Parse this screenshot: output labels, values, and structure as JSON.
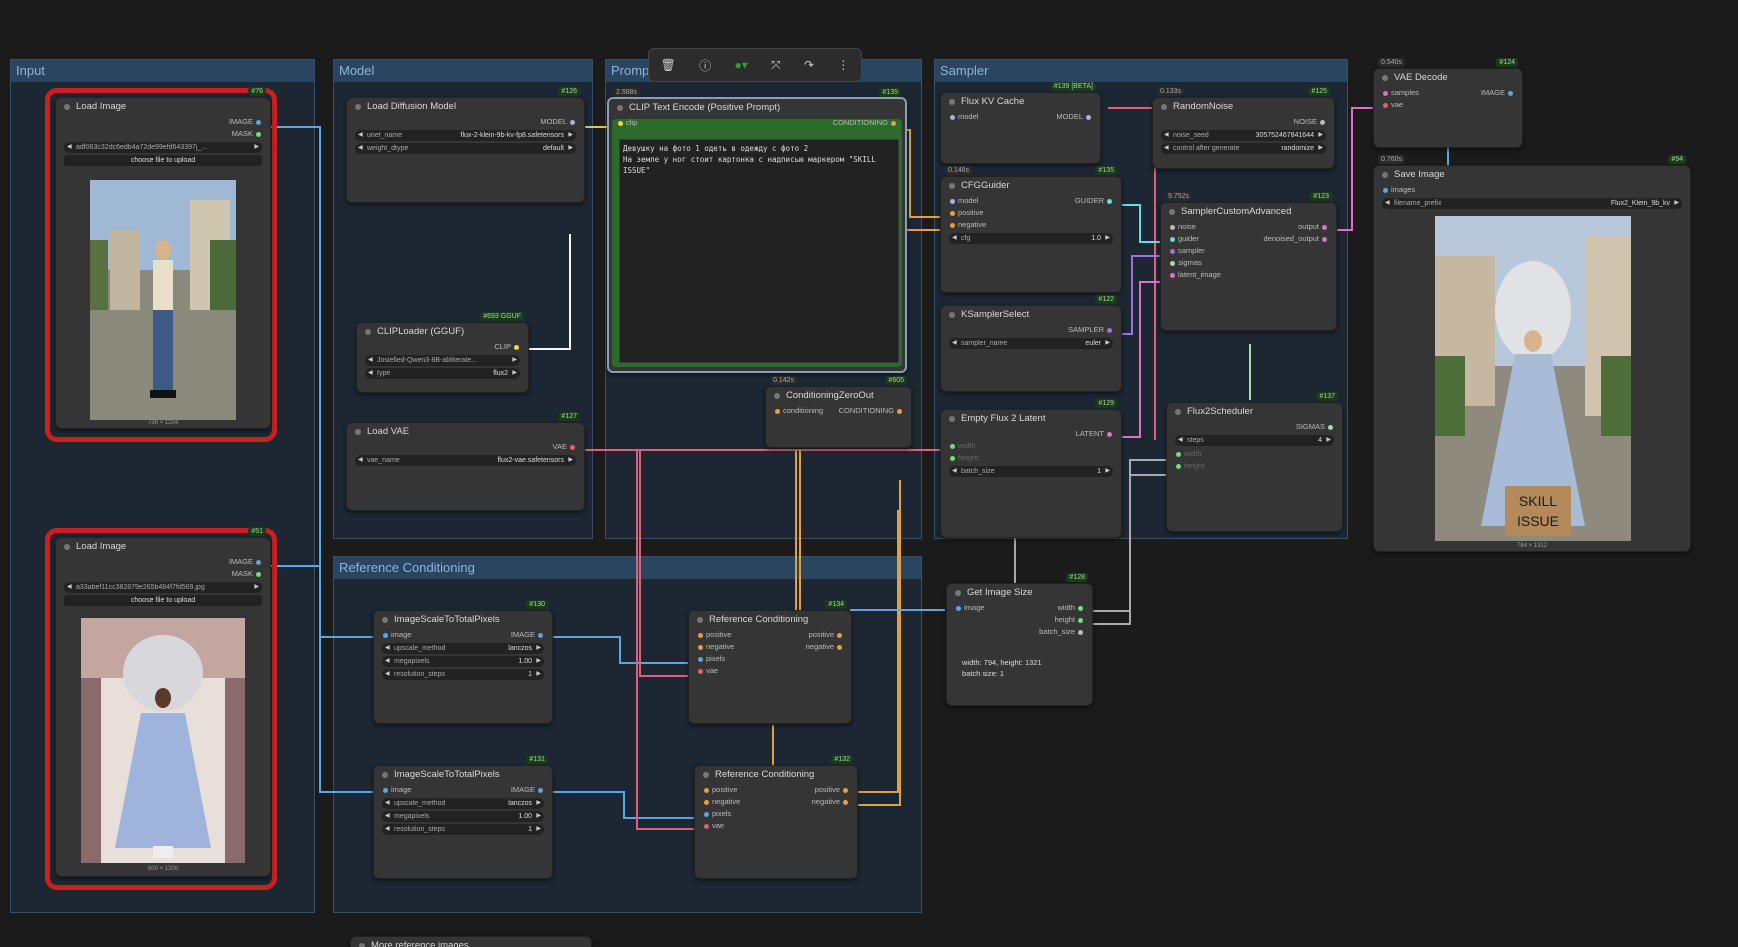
{
  "groups": {
    "input": "Input",
    "model": "Model",
    "prompt": "Promp",
    "sampler": "Sampler",
    "refcond": "Reference Conditioning"
  },
  "load1": {
    "title": "Load Image",
    "id": "#76",
    "out1": "IMAGE",
    "out2": "MASK",
    "file": "adf063c32dc6edb4a72de99efd643397j_...",
    "upload": "choose file to upload",
    "size": "736 × 1224"
  },
  "load2": {
    "title": "Load Image",
    "id": "#51",
    "out1": "IMAGE",
    "out2": "MASK",
    "file": "a33abef11cc382879e265b484f7fd569.jpg",
    "upload": "choose file to upload",
    "size": "500 × 1200"
  },
  "diff": {
    "title": "Load Diffusion Model",
    "id": "#126",
    "out": "MODEL",
    "w1l": "unet_name",
    "w1v": "flux-2-klein-9b-kv-fp8.safetensors",
    "w2l": "weight_dtype",
    "w2v": "default"
  },
  "clip": {
    "title": "CLIPLoader (GGUF)",
    "id": "#693 GGUF",
    "out": "CLIP",
    "w1v": "Josiefied-Qwen3-8B-abliterate...",
    "w2l": "type",
    "w2v": "flux2"
  },
  "vae": {
    "title": "Load VAE",
    "id": "#127",
    "out": "VAE",
    "w1l": "vae_name",
    "w1v": "flux2-vae.safetensors"
  },
  "textenc": {
    "title": "CLIP Text Encode (Positive Prompt)",
    "id": "#135",
    "time": "2.588s",
    "in": "clip",
    "out": "CONDITIONING",
    "text": "Девушку на фото 1 одеть в одежду с фото 2\nНа земле у ног стоит картонка с надписью маркером \"SKILL ISSUE\""
  },
  "zero": {
    "title": "ConditioningZeroOut",
    "id": "#605",
    "time": "0.142s",
    "in": "conditioning",
    "out": "CONDITIONING"
  },
  "kv": {
    "title": "Flux KV Cache",
    "id": "#139 [BETA]",
    "in": "model",
    "out": "MODEL"
  },
  "cfg": {
    "title": "CFGGuider",
    "id": "#135",
    "time": "0.146s",
    "in1": "model",
    "in2": "positive",
    "in3": "negative",
    "out": "GUIDER",
    "w1l": "cfg",
    "w1v": "1.0"
  },
  "ks": {
    "title": "KSamplerSelect",
    "id": "#122",
    "out": "SAMPLER",
    "w1l": "sampler_name",
    "w1v": "euler"
  },
  "efl": {
    "title": "Empty Flux 2 Latent",
    "id": "#129",
    "out": "LATENT",
    "w1": "width",
    "w2": "height",
    "w3l": "batch_size",
    "w3v": "1"
  },
  "noise": {
    "title": "RandomNoise",
    "id": "#125",
    "time": "0.133s",
    "out": "NOISE",
    "w1l": "noise_seed",
    "w1v": "305752467841644",
    "w2l": "control after generate",
    "w2v": "randomize"
  },
  "sca": {
    "title": "SamplerCustomAdvanced",
    "id": "#123",
    "time": "9.752s",
    "in1": "noise",
    "in2": "guider",
    "in3": "sampler",
    "in4": "sigmas",
    "in5": "latent_image",
    "out1": "output",
    "out2": "denoised_output"
  },
  "sched": {
    "title": "Flux2Scheduler",
    "id": "#137",
    "out": "SIGMAS",
    "w1l": "steps",
    "w1v": "4",
    "w2": "width",
    "w3": "height"
  },
  "vaed": {
    "title": "VAE Decode",
    "id": "#124",
    "time": "0.540s",
    "in1": "samples",
    "in2": "vae",
    "out": "IMAGE"
  },
  "save": {
    "title": "Save Image",
    "id": "#94",
    "time": "0.760s",
    "in": "images",
    "w1l": "filename_prefix",
    "w1v": "Flux2_Klein_9b_kv",
    "size": "784 × 1312",
    "sign": "SKILL\nISSUE"
  },
  "gis": {
    "title": "Get Image Size",
    "id": "#128",
    "in": "image",
    "o1": "width",
    "o2": "height",
    "o3": "batch_size",
    "info1": "width: 794, height: 1321",
    "info2": "batch size: 1"
  },
  "scale1": {
    "title": "ImageScaleToTotalPixels",
    "id": "#130",
    "in": "image",
    "out": "IMAGE",
    "w1l": "upscale_method",
    "w1v": "lanczos",
    "w2l": "megapixels",
    "w2v": "1.00",
    "w3l": "resolution_steps",
    "w3v": "1"
  },
  "scale2": {
    "title": "ImageScaleToTotalPixels",
    "id": "#131",
    "in": "image",
    "out": "IMAGE",
    "w1l": "upscale_method",
    "w1v": "lanczos",
    "w2l": "megapixels",
    "w2v": "1.00",
    "w3l": "resolution_steps",
    "w3v": "1"
  },
  "ref1": {
    "title": "Reference Conditioning",
    "id": "#134",
    "i1": "positive",
    "i2": "negative",
    "i3": "pixels",
    "i4": "vae",
    "o1": "positive",
    "o2": "negative"
  },
  "ref2": {
    "title": "Reference Conditioning",
    "id": "#132",
    "i1": "positive",
    "i2": "negative",
    "i3": "pixels",
    "i4": "vae",
    "o1": "positive",
    "o2": "negative"
  },
  "more": {
    "title": "More reference images"
  }
}
